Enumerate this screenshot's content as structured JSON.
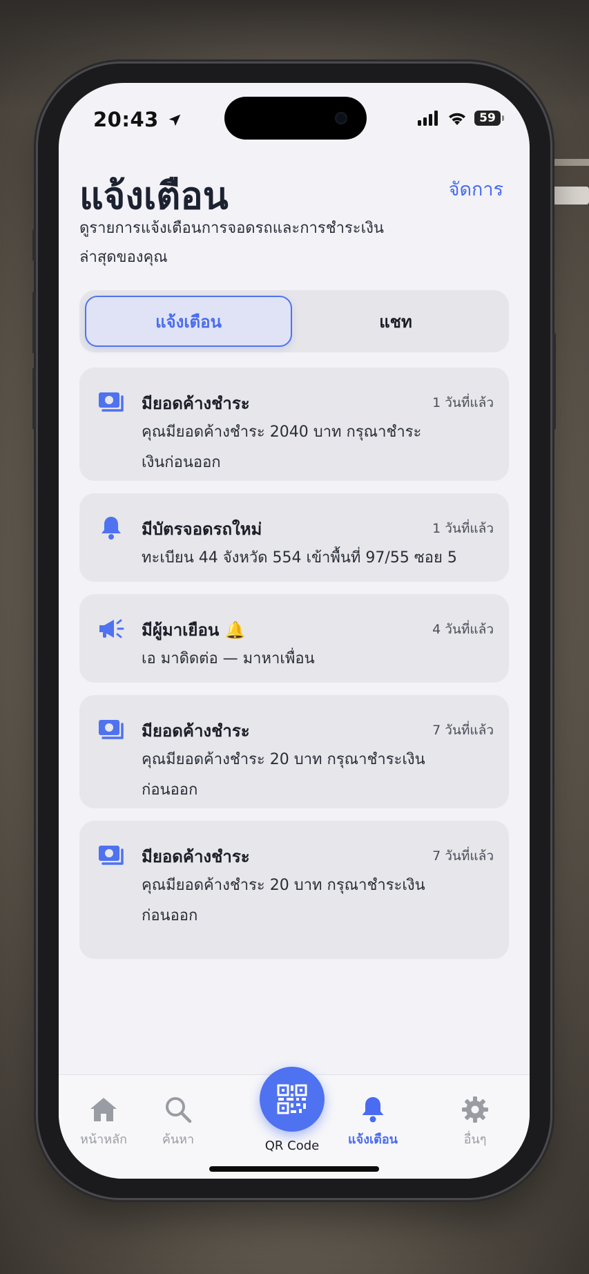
{
  "status": {
    "time": "20:43",
    "battery": "59"
  },
  "header": {
    "title": "แจ้งเตือน",
    "manage_label": "จัดการ",
    "subtitle": "ดูรายการแจ้งเตือนการจอดรถและการชำระเงินล่าสุดของคุณ"
  },
  "segment": {
    "tabs": [
      "แจ้งเตือน",
      "แชท"
    ],
    "active": 0
  },
  "notifications": [
    {
      "icon": "money-icon",
      "title": "มียอดค้างชำระ",
      "time": "1 วันที่แล้ว",
      "body": "คุณมียอดค้างชำระ 2040 บาท กรุณาชำระเงินก่อนออก"
    },
    {
      "icon": "bell-icon",
      "title": "มีบัตรจอดรถใหม่",
      "time": "1 วันที่แล้ว",
      "body": "ทะเบียน 44 จังหวัด 554 เข้าพื้นที่ 97/55 ซอย 5"
    },
    {
      "icon": "megaphone-icon",
      "title": "มีผู้มาเยือน 🔔",
      "time": "4 วันที่แล้ว",
      "body": "เอ มาดิดต่อ — มาหาเพื่อน"
    },
    {
      "icon": "money-icon",
      "title": "มียอดค้างชำระ",
      "time": "7 วันที่แล้ว",
      "body": "คุณมียอดค้างชำระ 20 บาท กรุณาชำระเงินก่อนออก"
    },
    {
      "icon": "money-icon",
      "title": "มียอดค้างชำระ",
      "time": "7 วันที่แล้ว",
      "body": "คุณมียอดค้างชำระ 20 บาท กรุณาชำระเงินก่อนออก"
    }
  ],
  "tabbar": {
    "home": "หน้าหลัก",
    "search": "ค้นหา",
    "qr": "QR Code",
    "notifications": "แจ้งเตือน",
    "more": "อื่นๆ",
    "active": "notifications"
  },
  "colors": {
    "accent": "#4a6cf0",
    "card": "#e6e6eb",
    "screen": "#f2f2f7"
  }
}
